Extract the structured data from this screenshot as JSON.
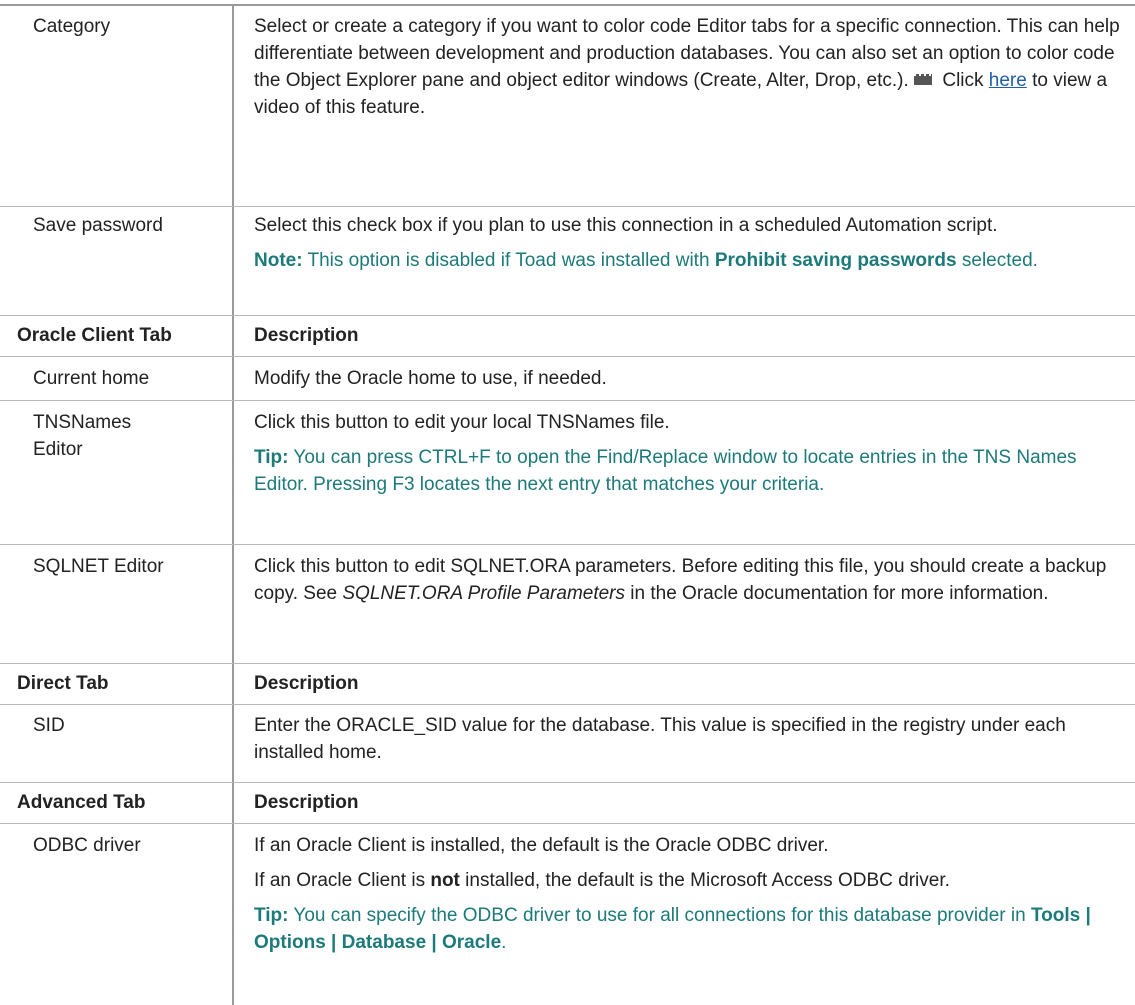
{
  "rows": {
    "category": {
      "label": "Category",
      "text_1": "Select or create a category if you want to color code Editor tabs for a specific connection. This can help differentiate between development and production databases. You can also set an option to color code the Object Explorer pane and object editor windows (Create, Alter, Drop, etc.).",
      "icon": "video-icon",
      "text_2": " Click ",
      "link": "here",
      "text_3": " to view a video of this feature."
    },
    "save_password": {
      "label": "Save password",
      "text": "Select this check box if you plan to use this connection in a scheduled Automation script.",
      "note_lead": "Note:",
      "note_text_1": " This option is disabled if Toad was installed with ",
      "note_bold": "Prohibit saving passwords",
      "note_text_2": " selected."
    },
    "oracle_client_header": {
      "label": "Oracle Client Tab",
      "desc": "Description"
    },
    "current_home": {
      "label": "Current home",
      "text": "Modify the Oracle home to use, if needed."
    },
    "tnsnames_editor": {
      "label": "TNSNames Editor",
      "text": "Click this button to edit your local TNSNames file.",
      "tip_lead": "Tip:",
      "tip_text": " You can press CTRL+F to open the Find/Replace window to locate entries in the TNS Names Editor. Pressing F3 locates the next entry that matches your criteria."
    },
    "sqlnet_editor": {
      "label": "SQLNET Editor",
      "text_1": "Click this button to edit SQLNET.ORA parameters. Before editing this file, you should create a backup copy. See ",
      "italic": "SQLNET.ORA Profile Parameters",
      "text_2": " in the Oracle documentation for more information."
    },
    "direct_header": {
      "label": "Direct Tab",
      "desc": "Description"
    },
    "sid": {
      "label": "SID",
      "text": "Enter the ORACLE_SID value for the database. This value is specified in the registry under each installed home."
    },
    "advanced_header": {
      "label": "Advanced Tab",
      "desc": "Description"
    },
    "odbc_driver": {
      "label": "ODBC driver",
      "text_1": "If an Oracle Client is installed, the default is the Oracle ODBC driver.",
      "text_2a": "If an Oracle Client is ",
      "text_2b": "not",
      "text_2c": " installed, the default is the Microsoft Access ODBC driver.",
      "tip_lead": "Tip:",
      "tip_text": " You can specify the ODBC driver to use for all connections for this database provider in ",
      "tip_bold": "Tools | Options | Database | Oracle",
      "tip_end": "."
    }
  }
}
